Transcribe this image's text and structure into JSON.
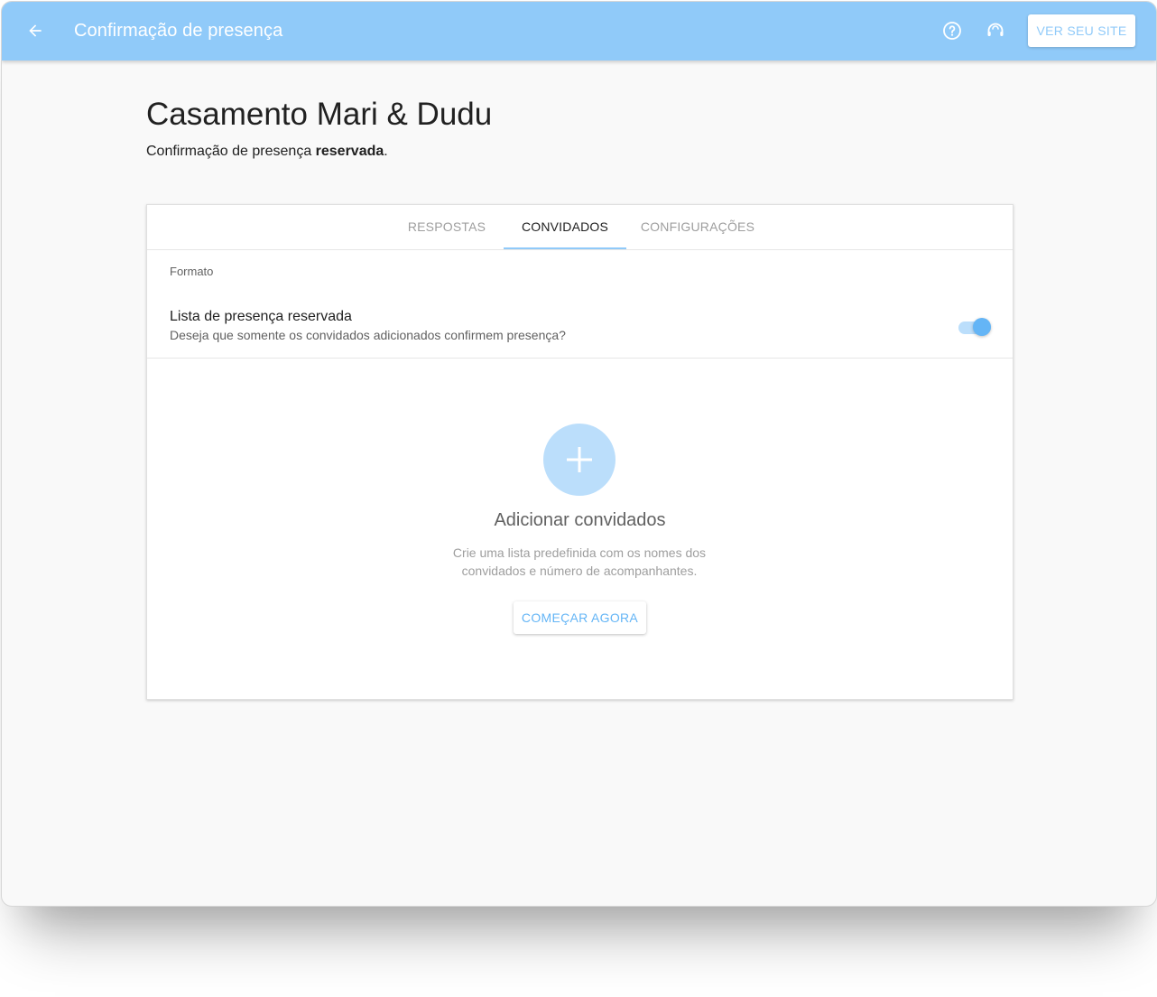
{
  "colors": {
    "appbar": "#90caf9",
    "accent": "#64b5f6",
    "accent_light": "#bbdefb",
    "background": "#f9f9f9"
  },
  "header": {
    "back_icon": "arrow-left-icon",
    "title": "Confirmação de presença",
    "help_icon": "help-circle-icon",
    "support_icon": "headset-icon",
    "site_button": "VER SEU SITE"
  },
  "page": {
    "title": "Casamento Mari & Dudu",
    "subtitle_prefix": "Confirmação de presença ",
    "subtitle_bold": "reservada",
    "subtitle_suffix": "."
  },
  "tabs": [
    {
      "label": "RESPOSTAS",
      "active": false
    },
    {
      "label": "CONVIDADOS",
      "active": true
    },
    {
      "label": "CONFIGURAÇÕES",
      "active": false
    }
  ],
  "format_section": {
    "label": "Formato",
    "setting_title": "Lista de presença reservada",
    "setting_description": "Deseja que somente os convidados adicionados confirmem presença?",
    "toggle_on": true
  },
  "empty_state": {
    "icon": "plus-icon",
    "title": "Adicionar convidados",
    "description": "Crie uma lista predefinida com os nomes dos convidados e número de acompanhantes.",
    "button": "COMEÇAR AGORA"
  }
}
